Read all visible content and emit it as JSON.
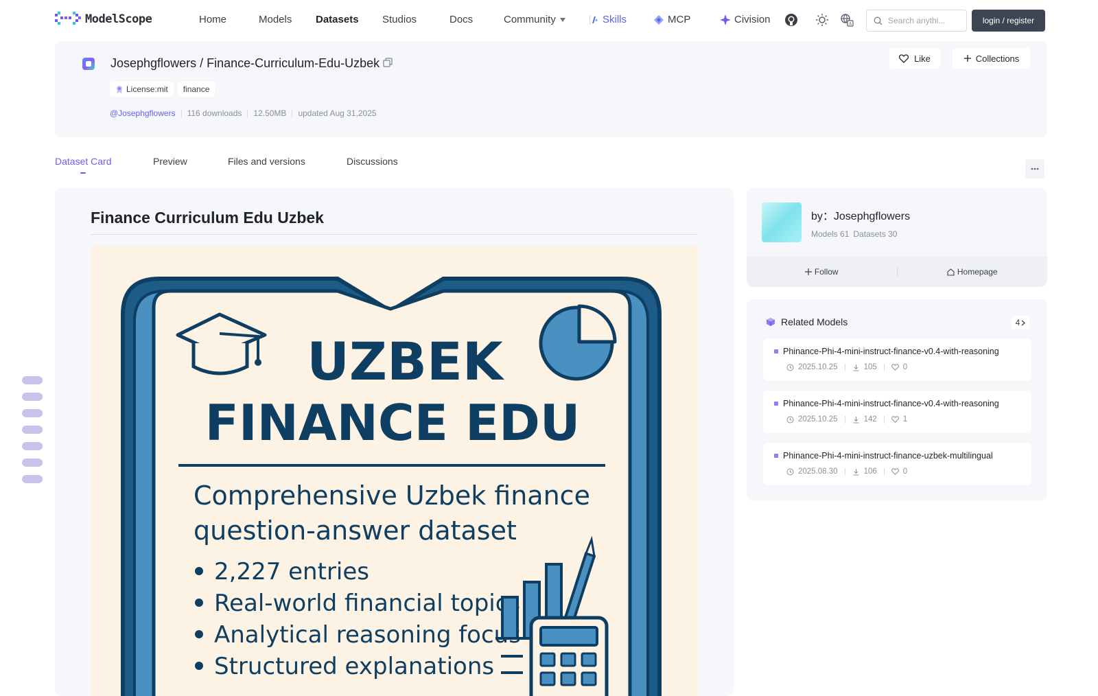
{
  "nav": {
    "logo_text": "ModelScope",
    "links": [
      "Home",
      "Models",
      "Datasets",
      "Studios",
      "Docs"
    ],
    "community": "Community",
    "skills": "Skills",
    "mcp": "MCP",
    "civision": "Civision",
    "search_placeholder": "Search anythi...",
    "login": "login / register"
  },
  "dataset": {
    "owner": "Josephgflowers",
    "name": "Finance-Curriculum-Edu-Uzbek",
    "title_sep": " / ",
    "tags": [
      "License:mit",
      "finance"
    ],
    "author_handle": "@Josephgflowers",
    "downloads": "116 downloads",
    "size": "12.50MB",
    "updated": "updated Aug 31,2025",
    "like": "Like",
    "collections": "Collections"
  },
  "tabs": [
    "Dataset Card",
    "Preview",
    "Files and versions",
    "Discussions"
  ],
  "card": {
    "title": "Finance Curriculum Edu Uzbek",
    "poster": {
      "heading1": "UZBEK",
      "heading2": "FINANCE EDU",
      "desc1": "Comprehensive Uzbek finance",
      "desc2": "question-answer dataset",
      "bullets": [
        "2,227 entries",
        "Real-world financial topics",
        "Analytical reasoning focus",
        "Structured explanations"
      ]
    }
  },
  "author": {
    "by": "by：Josephgflowers",
    "models": "Models 61",
    "datasets": "Datasets 30",
    "follow": "Follow",
    "homepage": "Homepage"
  },
  "related": {
    "title": "Related Models",
    "count": "4",
    "items": [
      {
        "name": "Phinance-Phi-4-mini-instruct-finance-v0.4-with-reasoning",
        "date": "2025.10.25",
        "downloads": "105",
        "likes": "0"
      },
      {
        "name": "Phinance-Phi-4-mini-instruct-finance-v0.4-with-reasoning",
        "date": "2025.10.25",
        "downloads": "142",
        "likes": "1"
      },
      {
        "name": "Phinance-Phi-4-mini-instruct-finance-uzbek-multilingual",
        "date": "2025.08.30",
        "downloads": "106",
        "likes": "0"
      }
    ]
  },
  "colors": {
    "accent": "#6b5cf0",
    "poster_bg": "#fdf3e4",
    "poster_dark": "#0f3e63",
    "poster_blue": "#4a90c0"
  }
}
